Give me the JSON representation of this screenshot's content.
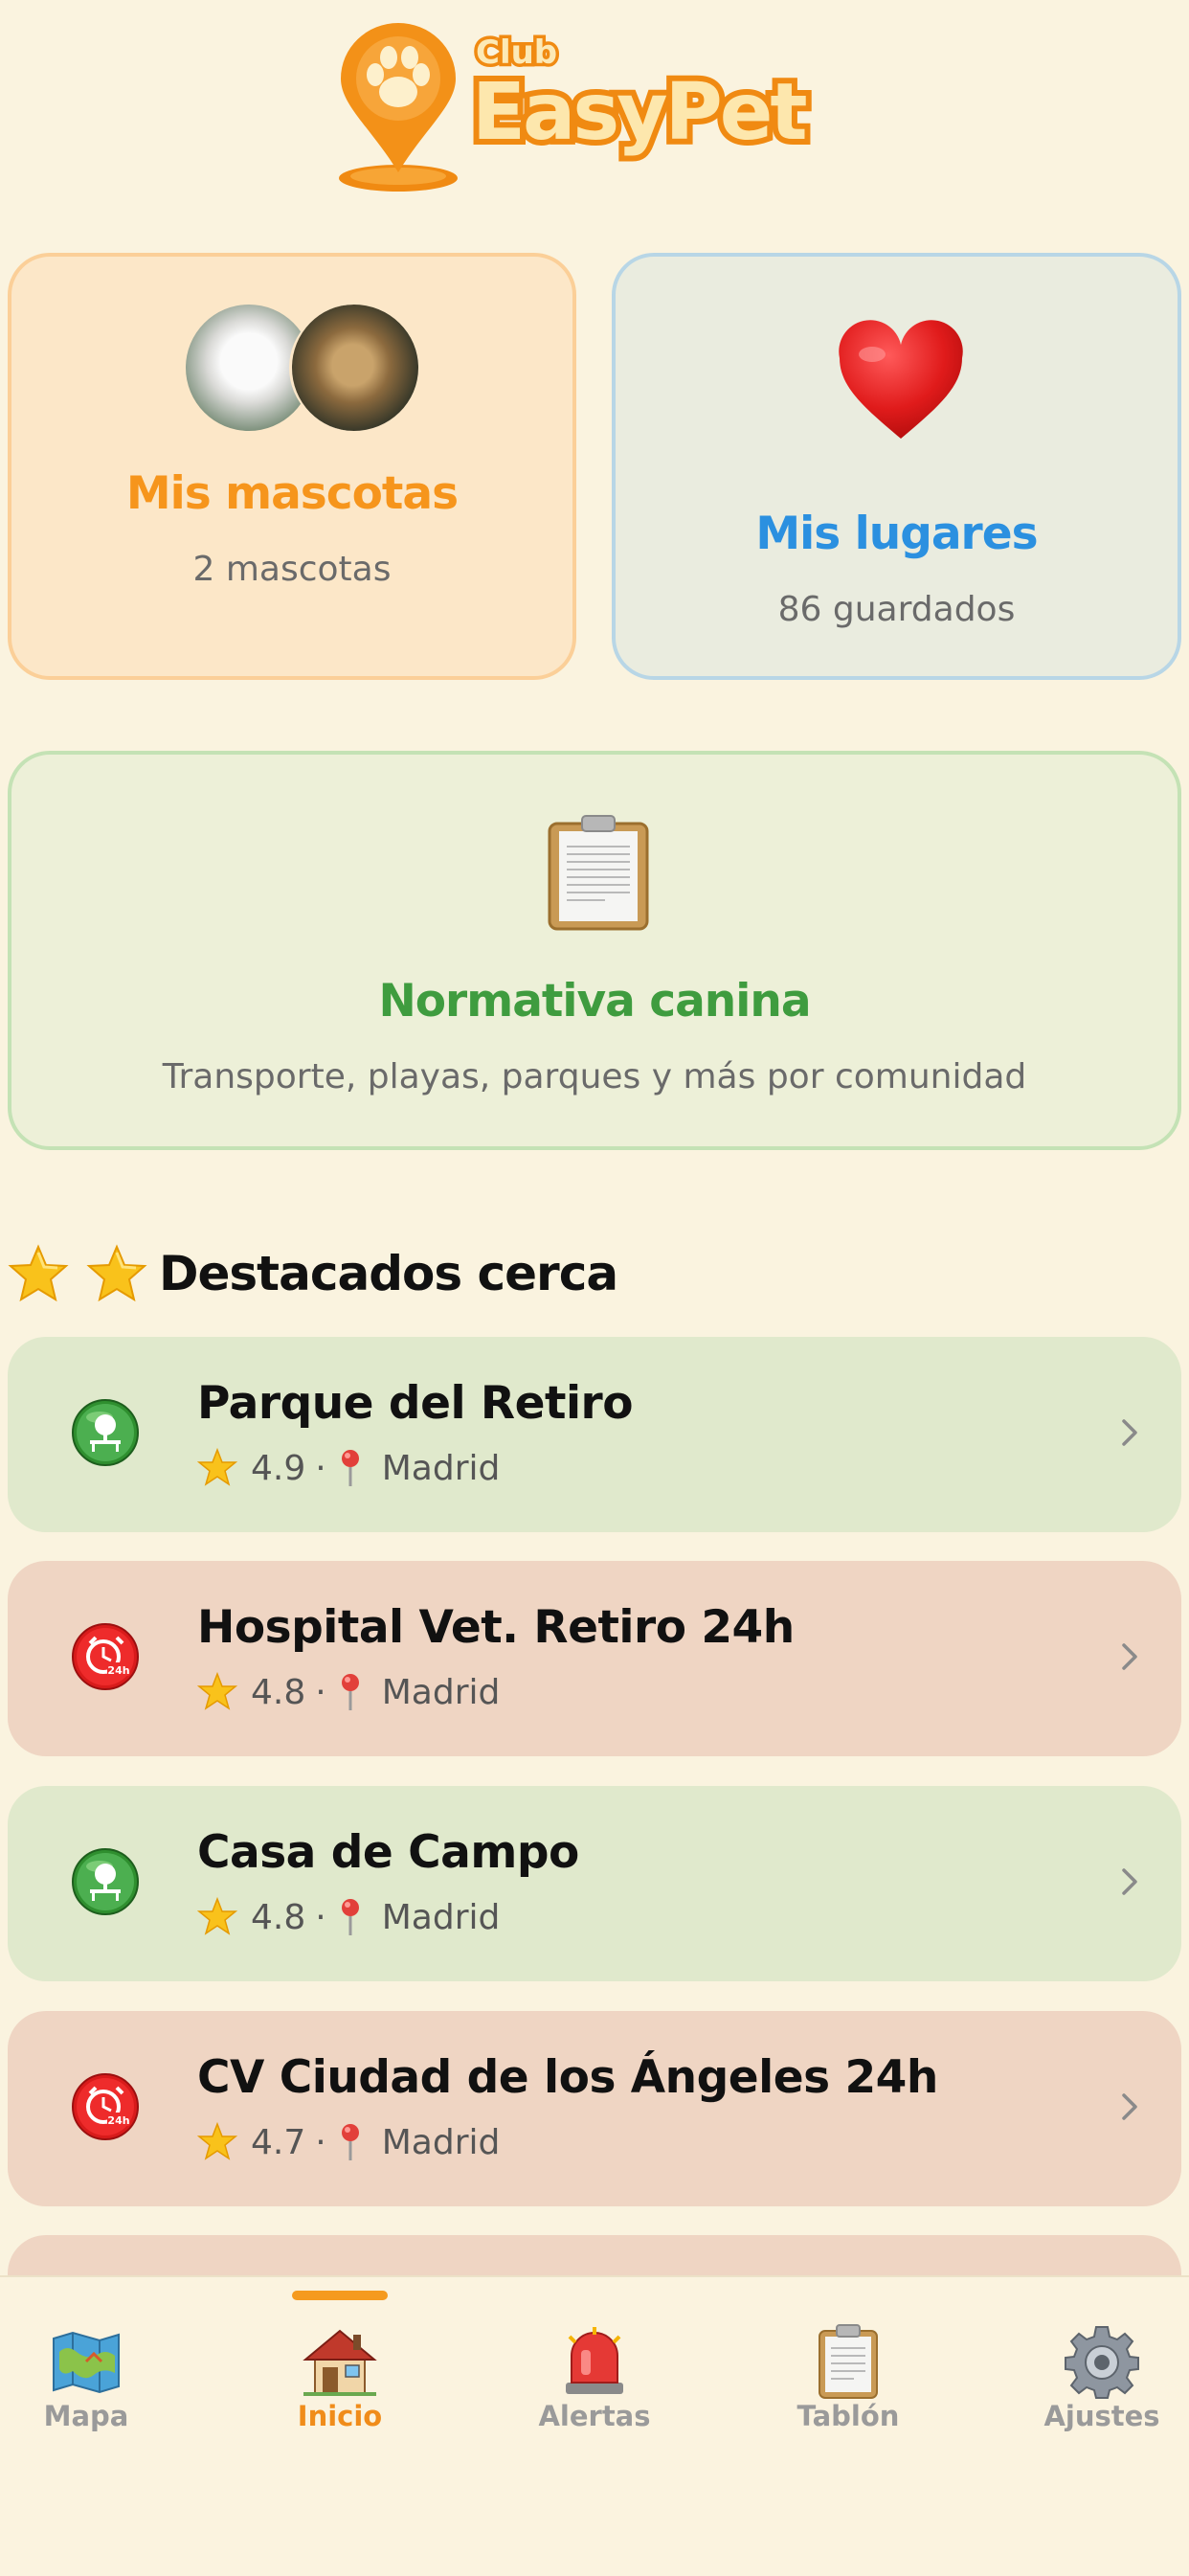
{
  "logo": {
    "club": "Club",
    "name": "EasyPet"
  },
  "cards": {
    "pets": {
      "title": "Mis mascotas",
      "subtitle": "2 mascotas"
    },
    "places": {
      "title": "Mis lugares",
      "subtitle": "86 guardados",
      "icon": "heart-icon"
    },
    "rules": {
      "title": "Normativa canina",
      "subtitle": "Transporte, playas, parques y más por comunidad",
      "icon": "clipboard-icon"
    }
  },
  "featured": {
    "title": "Destacados cerca",
    "items": [
      {
        "name": "Parque del Retiro",
        "rating": "4.9",
        "separator": "·",
        "city": "Madrid",
        "type": "park",
        "icon": "park-icon"
      },
      {
        "name": "Hospital Vet. Retiro 24h",
        "rating": "4.8",
        "separator": "·",
        "city": "Madrid",
        "type": "vet",
        "icon": "emergency-vet-icon"
      },
      {
        "name": "Casa de Campo",
        "rating": "4.8",
        "separator": "·",
        "city": "Madrid",
        "type": "park",
        "icon": "park-icon"
      },
      {
        "name": "CV Ciudad de los Ángeles 24h",
        "rating": "4.7",
        "separator": "·",
        "city": "Madrid",
        "type": "vet",
        "icon": "emergency-vet-icon"
      }
    ]
  },
  "tabs": [
    {
      "label": "Mapa",
      "icon": "map-icon",
      "active": false
    },
    {
      "label": "Inicio",
      "icon": "house-icon",
      "active": true
    },
    {
      "label": "Alertas",
      "icon": "siren-icon",
      "active": false
    },
    {
      "label": "Tablón",
      "icon": "clipboard-icon",
      "active": false
    },
    {
      "label": "Ajustes",
      "icon": "gear-icon",
      "active": false
    }
  ],
  "colors": {
    "background": "#faf3df",
    "accent_orange": "#f6951c",
    "accent_blue": "#2b90e0",
    "accent_green": "#3f9c3f",
    "park_card": "#e0e9cc",
    "vet_card": "#efd5c3"
  }
}
